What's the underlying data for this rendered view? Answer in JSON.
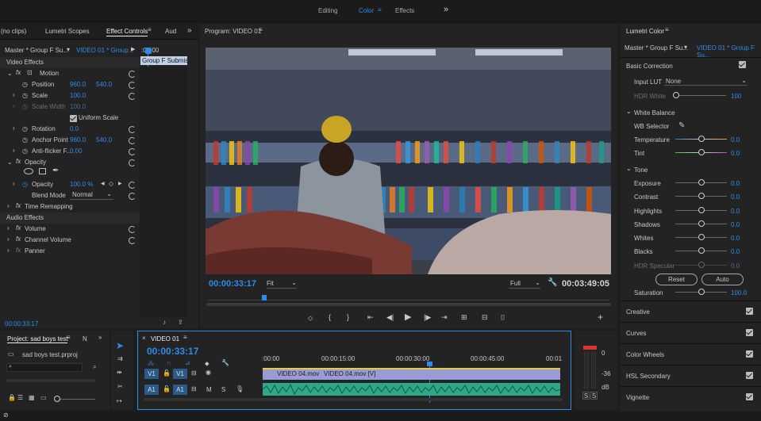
{
  "workspaces": {
    "editing": "Editing",
    "color": "Color",
    "effects": "Effects",
    "more": "»"
  },
  "left_tabs": {
    "source": "(no clips)",
    "lumetri_scopes": "Lumetri Scopes",
    "effect_controls": "Effect Controls",
    "audio": "Aud",
    "more": "»"
  },
  "effect_controls": {
    "master": "Master * Group F Su...",
    "clip": "VIDEO 01 * Group...",
    "timecode_ruler": ":00:00",
    "clip_label": "Group F Submissi",
    "video_effects": "Video Effects",
    "motion": "Motion",
    "position_label": "Position",
    "position_x": "960.0",
    "position_y": "540.0",
    "scale_label": "Scale",
    "scale_value": "100.0",
    "scale_width_label": "Scale Width",
    "scale_width_value": "100.0",
    "uniform_scale": "Uniform Scale",
    "rotation_label": "Rotation",
    "rotation_value": "0.0",
    "anchor_label": "Anchor Point",
    "anchor_x": "960.0",
    "anchor_y": "540.0",
    "antiflicker_label": "Anti-flicker F...",
    "antiflicker_value": "0.00",
    "opacity_group": "Opacity",
    "opacity_label": "Opacity",
    "opacity_value": "100.0 %",
    "blend_label": "Blend Mode",
    "blend_value": "Normal",
    "time_remapping": "Time Remapping",
    "audio_effects": "Audio Effects",
    "volume": "Volume",
    "channel_volume": "Channel Volume",
    "panner": "Panner",
    "bottom_time": "00:00:33:17"
  },
  "program": {
    "title": "Program: VIDEO 01",
    "timecode": "00:00:33:17",
    "fit": "Fit",
    "quality": "Full",
    "duration": "00:03:49:05"
  },
  "lumetri": {
    "title": "Lumetri Color",
    "master": "Master * Group F Su...",
    "clip": "VIDEO 01 * Group F Su...",
    "basic_correction": "Basic Correction",
    "input_lut_label": "Input LUT",
    "input_lut_value": "None",
    "hdr_white_label": "HDR White",
    "hdr_white_value": "100",
    "white_balance": "White Balance",
    "wb_selector": "WB Selector",
    "temperature_label": "Temperature",
    "temperature_value": "0.0",
    "tint_label": "Tint",
    "tint_value": "0.0",
    "tone": "Tone",
    "exposure_label": "Exposure",
    "exposure_value": "0.0",
    "contrast_label": "Contrast",
    "contrast_value": "0.0",
    "highlights_label": "Highlights",
    "highlights_value": "0.0",
    "shadows_label": "Shadows",
    "shadows_value": "0.0",
    "whites_label": "Whites",
    "whites_value": "0.0",
    "blacks_label": "Blacks",
    "blacks_value": "0.0",
    "hdr_specular_label": "HDR Specular",
    "hdr_specular_value": "0.0",
    "reset": "Reset",
    "auto": "Auto",
    "saturation_label": "Saturation",
    "saturation_value": "100.0",
    "sections": [
      "Creative",
      "Curves",
      "Color Wheels",
      "HSL Secondary",
      "Vignette"
    ]
  },
  "project": {
    "tab": "Project: sad boys test",
    "tab2": "N",
    "file": "sad boys test.prproj"
  },
  "timeline": {
    "name": "VIDEO 01",
    "timecode": "00:00:33:17",
    "ticks": [
      ":00:00",
      "00:00:15:00",
      "00:00:30:00",
      "00:00:45:00",
      "00:01"
    ],
    "v1": "V1",
    "a1": "A1",
    "clip_v1": "VIDEO 04.mov",
    "clip_v2": "VIDEO 04.mov [V]",
    "m": "M",
    "s": "S"
  },
  "meter": {
    "labels": [
      "0",
      "-36",
      "dB"
    ],
    "solo": "S"
  }
}
